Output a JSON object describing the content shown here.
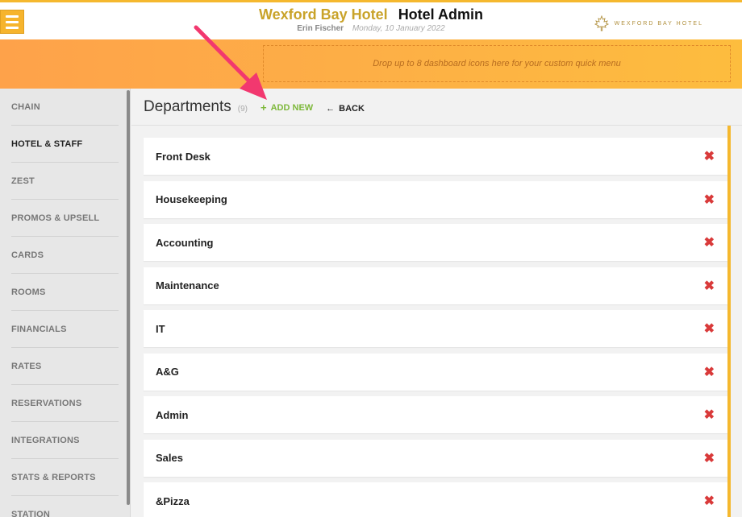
{
  "header": {
    "hotel_name": "Wexford Bay Hotel",
    "app_name": "Hotel Admin",
    "user_name": "Erin Fischer",
    "date": "Monday, 10 January 2022",
    "brand_text": "WEXFORD BAY HOTEL",
    "menu_icon": "hamburger-menu-icon",
    "brand_icon": "maple-leaf-icon",
    "accent_color": "#f5b82e"
  },
  "quick_menu": {
    "placeholder": "Drop up to 8 dashboard icons here for your custom quick menu"
  },
  "sidebar": {
    "items": [
      {
        "label": "CHAIN"
      },
      {
        "label": "HOTEL & STAFF"
      },
      {
        "label": "ZEST"
      },
      {
        "label": "PROMOS & UPSELL"
      },
      {
        "label": "CARDS"
      },
      {
        "label": "ROOMS"
      },
      {
        "label": "FINANCIALS"
      },
      {
        "label": "RATES"
      },
      {
        "label": "RESERVATIONS"
      },
      {
        "label": "INTEGRATIONS"
      },
      {
        "label": "STATS & REPORTS"
      },
      {
        "label": "STATION"
      }
    ],
    "active": "HOTEL & STAFF"
  },
  "main": {
    "title": "Departments",
    "count": "(9)",
    "add_new_label": "ADD NEW",
    "back_label": "BACK",
    "delete_icon": "x-icon",
    "delete_color": "#d93a3a",
    "add_color": "#7db83a",
    "departments": [
      {
        "name": "Front Desk"
      },
      {
        "name": "Housekeeping"
      },
      {
        "name": "Accounting"
      },
      {
        "name": "Maintenance"
      },
      {
        "name": "IT"
      },
      {
        "name": "A&G"
      },
      {
        "name": "Admin"
      },
      {
        "name": "Sales"
      },
      {
        "name": "&Pizza"
      }
    ]
  },
  "annotation": {
    "arrow_color": "#f2386f"
  }
}
